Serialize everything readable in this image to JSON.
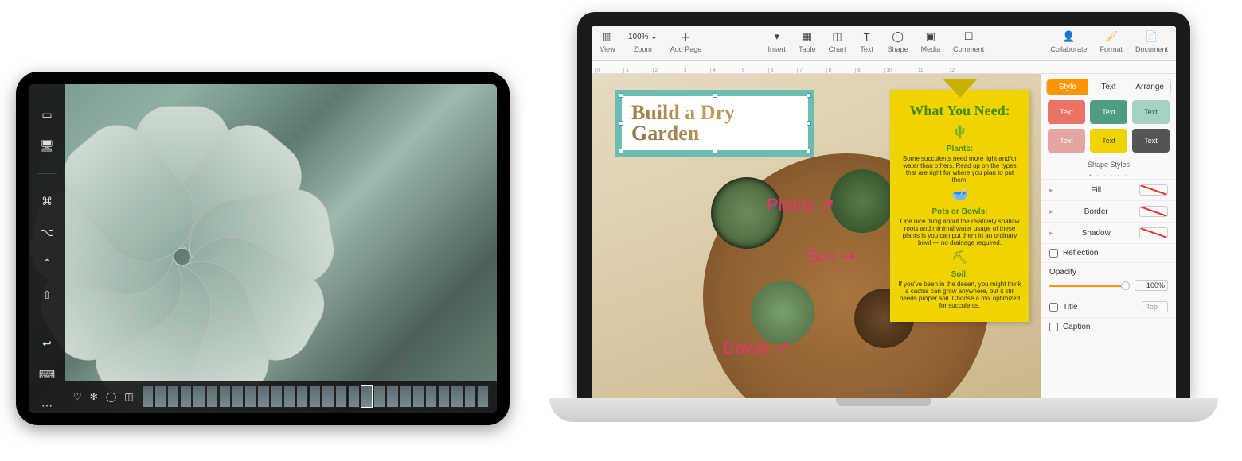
{
  "ipad": {
    "sidebar": {
      "items": [
        {
          "name": "sidecar-icon",
          "glyph": "▭"
        },
        {
          "name": "display-icon",
          "glyph": "🖥"
        },
        {
          "name": "command-icon",
          "glyph": "⌘"
        },
        {
          "name": "option-icon",
          "glyph": "⌥"
        },
        {
          "name": "control-icon",
          "glyph": "⌃"
        },
        {
          "name": "shift-icon",
          "glyph": "⇧"
        },
        {
          "name": "undo-icon",
          "glyph": "↩"
        },
        {
          "name": "keyboard-icon",
          "glyph": "⌨"
        },
        {
          "name": "disconnect-icon",
          "glyph": "⋯"
        }
      ]
    },
    "bottombar": {
      "favorite": "♡",
      "adjust": "✻",
      "filters": "◯",
      "crop": "◫"
    }
  },
  "mac": {
    "base_label": "MacBook Air",
    "toolbar_left": [
      {
        "name": "view",
        "label": "View",
        "glyph": "▥"
      },
      {
        "name": "zoom",
        "label": "Zoom",
        "glyph": "100% ⌄"
      },
      {
        "name": "add-page",
        "label": "Add Page",
        "glyph": "＋"
      }
    ],
    "toolbar_center": [
      {
        "name": "insert",
        "label": "Insert",
        "glyph": "▾"
      },
      {
        "name": "table",
        "label": "Table",
        "glyph": "▦"
      },
      {
        "name": "chart",
        "label": "Chart",
        "glyph": "◫"
      },
      {
        "name": "text",
        "label": "Text",
        "glyph": "T"
      },
      {
        "name": "shape",
        "label": "Shape",
        "glyph": "◯"
      },
      {
        "name": "media",
        "label": "Media",
        "glyph": "▣"
      },
      {
        "name": "comment",
        "label": "Comment",
        "glyph": "☐"
      }
    ],
    "toolbar_right": [
      {
        "name": "collaborate",
        "label": "Collaborate",
        "glyph": "👤"
      },
      {
        "name": "format",
        "label": "Format",
        "glyph": "🖌"
      },
      {
        "name": "document",
        "label": "Document",
        "glyph": "📄"
      }
    ],
    "ruler": [
      "0",
      "1",
      "2",
      "3",
      "4",
      "5",
      "6",
      "7",
      "8",
      "9",
      "10",
      "11",
      "12"
    ],
    "canvas": {
      "title": "Build a Dry Garden",
      "hand_labels": [
        "Plants",
        "Soil",
        "Bowls"
      ],
      "info": {
        "heading": "What You Need:",
        "sections": [
          {
            "title": "Plants:",
            "body": "Some succulents need more light and/or water than others. Read up on the types that are right for where you plan to put them."
          },
          {
            "title": "Pots or Bowls:",
            "body": "One nice thing about the relatively shallow roots and minimal water usage of these plants is you can put them in an ordinary bowl — no drainage required."
          },
          {
            "title": "Soil:",
            "body": "If you've been in the desert, you might think a cactus can grow anywhere, but it still needs proper soil. Choose a mix optimized for succulents."
          }
        ]
      }
    },
    "inspector": {
      "tabs": [
        "Style",
        "Text",
        "Arrange"
      ],
      "active_tab": 0,
      "swatches_row1": [
        {
          "label": "Text",
          "bg": "#e97365"
        },
        {
          "label": "Text",
          "bg": "#4f9c84"
        },
        {
          "label": "Text",
          "bg": "#a4d4c1"
        }
      ],
      "swatches_row2": [
        {
          "label": "Text",
          "bg": "#e5a5a0"
        },
        {
          "label": "Text",
          "bg": "#f0d400",
          "fg": "#3a3a3a"
        },
        {
          "label": "Text",
          "bg": "#555"
        }
      ],
      "shape_styles_label": "Shape Styles",
      "props": [
        "Fill",
        "Border",
        "Shadow"
      ],
      "reflection_label": "Reflection",
      "opacity_label": "Opacity",
      "opacity_value": "100%",
      "title_label": "Title",
      "title_dropdown": "Top",
      "caption_label": "Caption"
    }
  }
}
